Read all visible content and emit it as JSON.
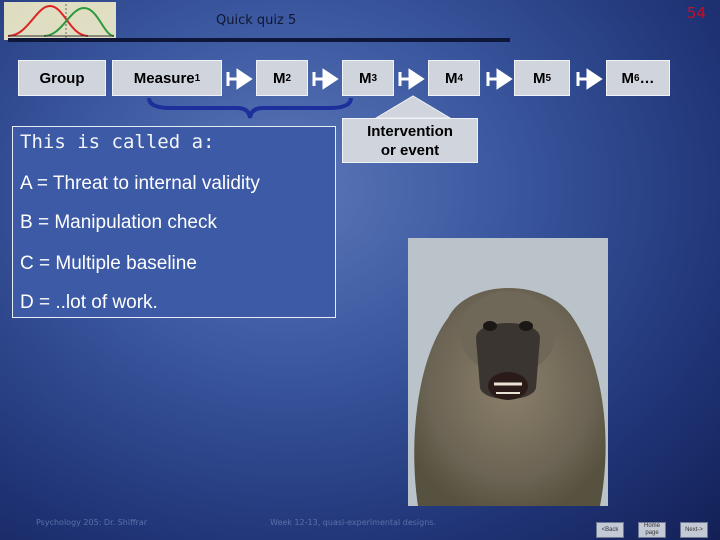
{
  "header": {
    "title": "Quick quiz 5",
    "page_number": "54"
  },
  "flow": {
    "group": "Group",
    "measure1": {
      "base": "Measure",
      "sub": "1"
    },
    "m2": {
      "base": "M",
      "sub": "2"
    },
    "m3": {
      "base": "M",
      "sub": "3"
    },
    "m4": {
      "base": "M",
      "sub": "4"
    },
    "m5": {
      "base": "M",
      "sub": "5"
    },
    "m6": {
      "base": "M",
      "sub": "6",
      "suffix": "…"
    },
    "intervention_line1": "Intervention",
    "intervention_line2": "or event"
  },
  "quiz": {
    "question": "This is called a:",
    "options": [
      "A = Threat to internal validity",
      "B = Manipulation check",
      "C = Multiple baseline",
      "D = ..lot of work."
    ]
  },
  "footer": {
    "left": "Psychology 205: Dr. Shiffrar",
    "center": "Week 12-13, quasi-experimental designs.",
    "back": "<Back",
    "home": "Home page",
    "next": "Next->"
  },
  "colors": {
    "accent": "#c0102a",
    "background": "#2b4288",
    "box": "#cfd4dd",
    "brace": "#1d2f9a"
  }
}
